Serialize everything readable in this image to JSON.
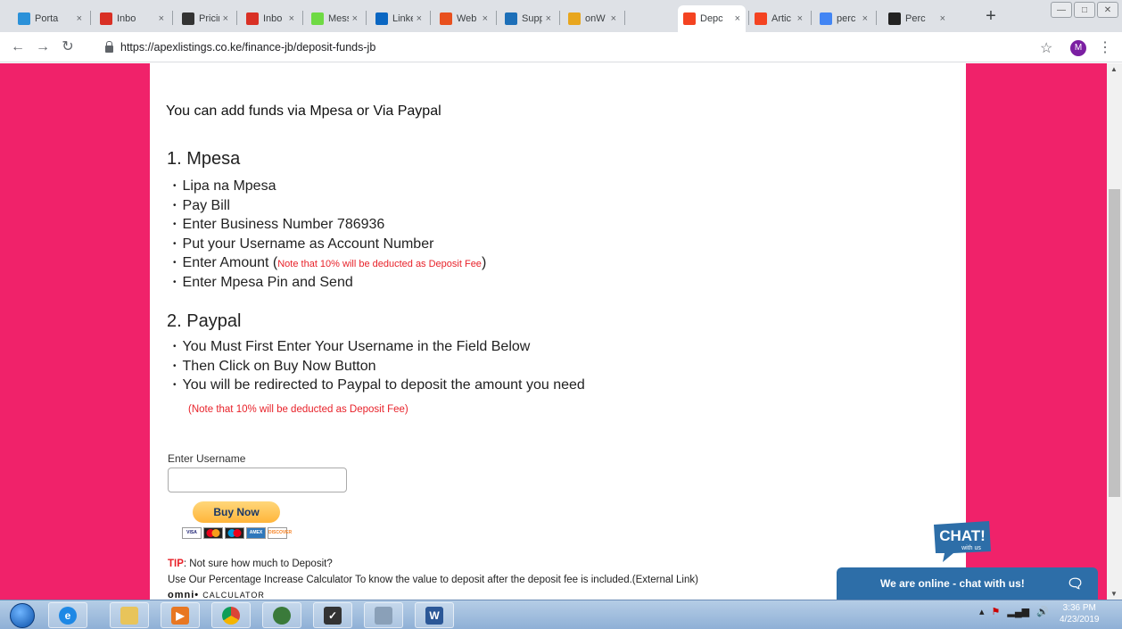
{
  "browser": {
    "tabs": [
      {
        "label": "Porta",
        "icon": "portal-icon",
        "color": "#2b91d9"
      },
      {
        "label": "Inbo",
        "icon": "gmail-icon",
        "color": "#d93025"
      },
      {
        "label": "Pricir",
        "icon": "pricing-icon",
        "color": "#333333"
      },
      {
        "label": "Inbo",
        "icon": "gmail-icon",
        "color": "#d93025"
      },
      {
        "label": "Mess",
        "icon": "upwork-icon",
        "color": "#6fda44"
      },
      {
        "label": "Linke",
        "icon": "linkedin-icon",
        "color": "#0a66c2"
      },
      {
        "label": "Web",
        "icon": "web-icon",
        "color": "#e8501e"
      },
      {
        "label": "Supp",
        "icon": "support-icon",
        "color": "#1d6fb8"
      },
      {
        "label": "onW",
        "icon": "onw-icon",
        "color": "#e8a61e"
      },
      {
        "label": "Depc",
        "icon": "joomla-icon",
        "color": "#f44321",
        "active": true
      },
      {
        "label": "Artic",
        "icon": "joomla-icon",
        "color": "#f44321"
      },
      {
        "label": "perc",
        "icon": "google-icon",
        "color": "#4285f4"
      },
      {
        "label": "Perc",
        "icon": "omni-icon",
        "color": "#222222"
      }
    ],
    "url": "https://apexlistings.co.ke/finance-jb/deposit-funds-jb",
    "profile_initial": "M"
  },
  "page": {
    "intro": "You can add funds via Mpesa or Via Paypal",
    "mpesa": {
      "heading": "1. Mpesa",
      "steps": [
        "Lipa na Mpesa",
        "Pay Bill",
        "Enter Business Number 786936",
        "Put your Username as Account Number",
        "Enter Amount (",
        "Enter Mpesa Pin and Send"
      ],
      "amount_note": "Note that 10% will be deducted as Deposit Fee",
      "amount_close": ")"
    },
    "paypal": {
      "heading": "2. Paypal",
      "steps": [
        "You Must First Enter Your Username in the Field Below",
        "Then Click on Buy Now Button",
        "You will be redirected to Paypal to deposit the amount you need"
      ],
      "note": "(Note that 10% will be deducted as Deposit Fee)"
    },
    "form": {
      "username_label": "Enter Username",
      "username_value": "",
      "buy_now": "Buy Now",
      "cards": [
        "VISA",
        "MC",
        "MAESTRO",
        "AMEX",
        "DISCOVER"
      ]
    },
    "tip": {
      "label": "TIP",
      "text": ": Not sure how much to Deposit?",
      "line": "Use Our Percentage Increase Calculator To know the value to deposit after the deposit fee is included.(External Link)",
      "logo_word": "omni",
      "logo_word2": "CALCULATOR"
    },
    "chat": {
      "badge_text": "CHAT!",
      "badge_sub": "with us",
      "bar_text": "We are online - chat with us!"
    }
  },
  "taskbar": {
    "time": "3:36 PM",
    "date": "4/23/2019"
  },
  "colors": {
    "page_bg": "#f0226a",
    "chat_blue": "#2d6ea8",
    "note_red": "#e8222a"
  }
}
